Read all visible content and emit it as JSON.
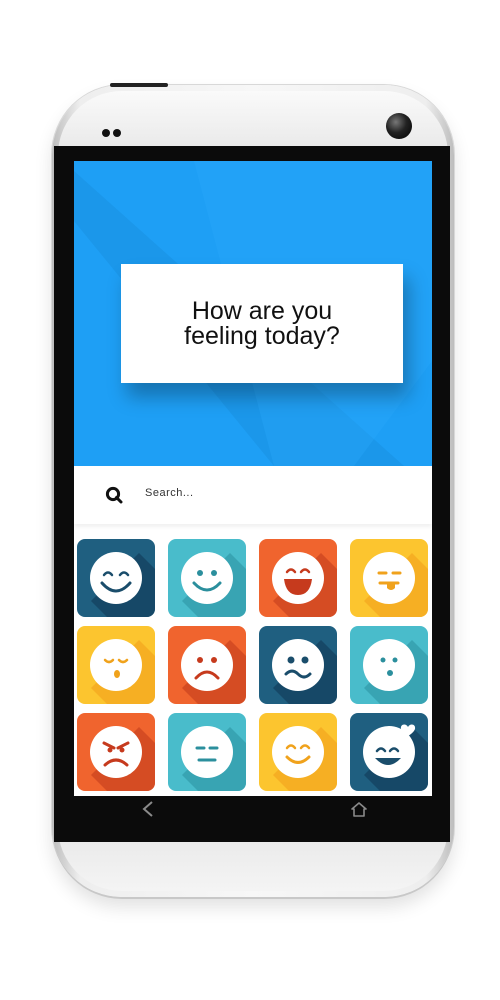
{
  "prompt": {
    "line1": "How are you",
    "line2": "feeling today?"
  },
  "search": {
    "placeholder": "Search...",
    "icon": "search-icon"
  },
  "colors": {
    "hero_blue": "#1e9ff5",
    "navy": "#1f5f80",
    "teal": "#49bccb",
    "orange": "#f0642e",
    "yellow": "#fcc52f"
  },
  "moods": [
    {
      "id": "wink-smile",
      "color": "navy"
    },
    {
      "id": "happy",
      "color": "teal"
    },
    {
      "id": "laughing",
      "color": "orange"
    },
    {
      "id": "tongue-out",
      "color": "yellow"
    },
    {
      "id": "sleepy",
      "color": "yellow"
    },
    {
      "id": "sad",
      "color": "orange"
    },
    {
      "id": "worried",
      "color": "navy"
    },
    {
      "id": "surprised",
      "color": "teal"
    },
    {
      "id": "angry",
      "color": "orange"
    },
    {
      "id": "neutral",
      "color": "teal"
    },
    {
      "id": "smile",
      "color": "yellow"
    },
    {
      "id": "in-love",
      "color": "navy"
    }
  ],
  "nav": {
    "back_icon": "back-arrow-icon",
    "home_icon": "home-icon"
  }
}
